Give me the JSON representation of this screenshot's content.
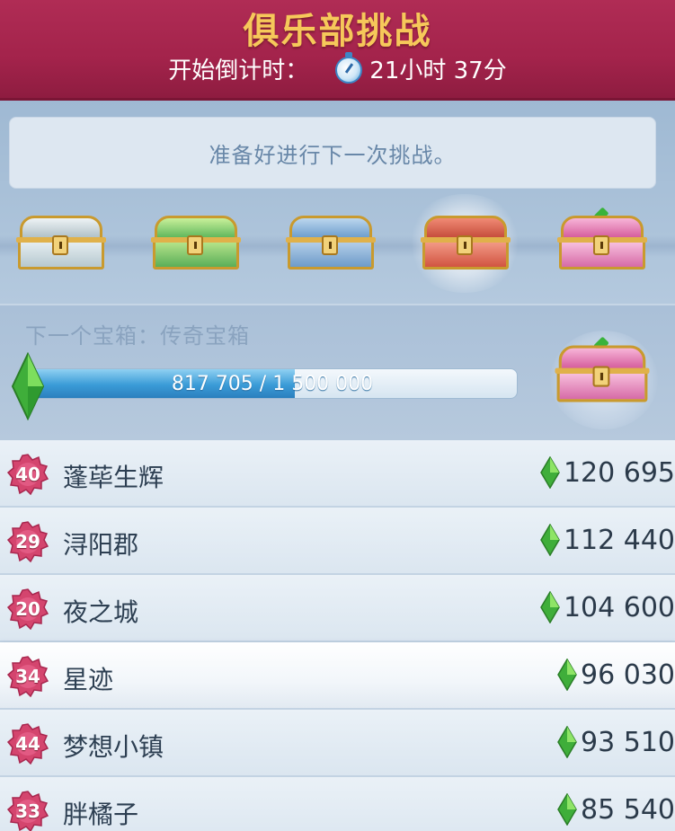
{
  "header": {
    "title": "俱乐部挑战",
    "countdown_label": "开始倒计时：",
    "countdown_value": "21小时 37分"
  },
  "message": "准备好进行下一次挑战。",
  "chests": [
    {
      "type": "silver-chest"
    },
    {
      "type": "green-chest"
    },
    {
      "type": "blue-chest"
    },
    {
      "type": "red-chest",
      "highlighted": true
    },
    {
      "type": "pink-chest"
    }
  ],
  "progress": {
    "next_label": "下一个宝箱：传奇宝箱",
    "text": "817 705 / 1 500 000",
    "current": 817705,
    "target": 1500000
  },
  "leaderboard": [
    {
      "level": "40",
      "name": "蓬荜生辉",
      "score": "120 695"
    },
    {
      "level": "29",
      "name": "浔阳郡",
      "score": "112 440"
    },
    {
      "level": "20",
      "name": "夜之城",
      "score": "104 600"
    },
    {
      "level": "34",
      "name": "星迹",
      "score": "96 030",
      "highlighted": true
    },
    {
      "level": "44",
      "name": "梦想小镇",
      "score": "93 510"
    },
    {
      "level": "33",
      "name": "胖橘子",
      "score": "85 540"
    }
  ],
  "colors": {
    "header_bg": "#a3234b",
    "title_gold": "#f6c85a",
    "progress_blue": "#3a9bd7",
    "badge_pink": "#d4456e",
    "plumbob_green": "#4cc041"
  }
}
